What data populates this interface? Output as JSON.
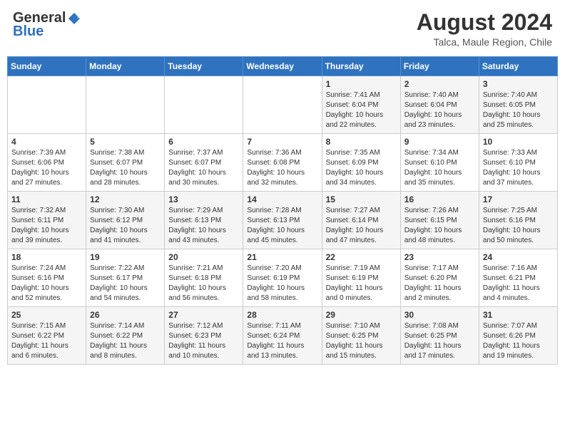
{
  "header": {
    "logo_general": "General",
    "logo_blue": "Blue",
    "month_year": "August 2024",
    "location": "Talca, Maule Region, Chile"
  },
  "days_of_week": [
    "Sunday",
    "Monday",
    "Tuesday",
    "Wednesday",
    "Thursday",
    "Friday",
    "Saturday"
  ],
  "weeks": [
    [
      {
        "day": "",
        "info": ""
      },
      {
        "day": "",
        "info": ""
      },
      {
        "day": "",
        "info": ""
      },
      {
        "day": "",
        "info": ""
      },
      {
        "day": "1",
        "info": "Sunrise: 7:41 AM\nSunset: 6:04 PM\nDaylight: 10 hours\nand 22 minutes."
      },
      {
        "day": "2",
        "info": "Sunrise: 7:40 AM\nSunset: 6:04 PM\nDaylight: 10 hours\nand 23 minutes."
      },
      {
        "day": "3",
        "info": "Sunrise: 7:40 AM\nSunset: 6:05 PM\nDaylight: 10 hours\nand 25 minutes."
      }
    ],
    [
      {
        "day": "4",
        "info": "Sunrise: 7:39 AM\nSunset: 6:06 PM\nDaylight: 10 hours\nand 27 minutes."
      },
      {
        "day": "5",
        "info": "Sunrise: 7:38 AM\nSunset: 6:07 PM\nDaylight: 10 hours\nand 28 minutes."
      },
      {
        "day": "6",
        "info": "Sunrise: 7:37 AM\nSunset: 6:07 PM\nDaylight: 10 hours\nand 30 minutes."
      },
      {
        "day": "7",
        "info": "Sunrise: 7:36 AM\nSunset: 6:08 PM\nDaylight: 10 hours\nand 32 minutes."
      },
      {
        "day": "8",
        "info": "Sunrise: 7:35 AM\nSunset: 6:09 PM\nDaylight: 10 hours\nand 34 minutes."
      },
      {
        "day": "9",
        "info": "Sunrise: 7:34 AM\nSunset: 6:10 PM\nDaylight: 10 hours\nand 35 minutes."
      },
      {
        "day": "10",
        "info": "Sunrise: 7:33 AM\nSunset: 6:10 PM\nDaylight: 10 hours\nand 37 minutes."
      }
    ],
    [
      {
        "day": "11",
        "info": "Sunrise: 7:32 AM\nSunset: 6:11 PM\nDaylight: 10 hours\nand 39 minutes."
      },
      {
        "day": "12",
        "info": "Sunrise: 7:30 AM\nSunset: 6:12 PM\nDaylight: 10 hours\nand 41 minutes."
      },
      {
        "day": "13",
        "info": "Sunrise: 7:29 AM\nSunset: 6:13 PM\nDaylight: 10 hours\nand 43 minutes."
      },
      {
        "day": "14",
        "info": "Sunrise: 7:28 AM\nSunset: 6:13 PM\nDaylight: 10 hours\nand 45 minutes."
      },
      {
        "day": "15",
        "info": "Sunrise: 7:27 AM\nSunset: 6:14 PM\nDaylight: 10 hours\nand 47 minutes."
      },
      {
        "day": "16",
        "info": "Sunrise: 7:26 AM\nSunset: 6:15 PM\nDaylight: 10 hours\nand 48 minutes."
      },
      {
        "day": "17",
        "info": "Sunrise: 7:25 AM\nSunset: 6:16 PM\nDaylight: 10 hours\nand 50 minutes."
      }
    ],
    [
      {
        "day": "18",
        "info": "Sunrise: 7:24 AM\nSunset: 6:16 PM\nDaylight: 10 hours\nand 52 minutes."
      },
      {
        "day": "19",
        "info": "Sunrise: 7:22 AM\nSunset: 6:17 PM\nDaylight: 10 hours\nand 54 minutes."
      },
      {
        "day": "20",
        "info": "Sunrise: 7:21 AM\nSunset: 6:18 PM\nDaylight: 10 hours\nand 56 minutes."
      },
      {
        "day": "21",
        "info": "Sunrise: 7:20 AM\nSunset: 6:19 PM\nDaylight: 10 hours\nand 58 minutes."
      },
      {
        "day": "22",
        "info": "Sunrise: 7:19 AM\nSunset: 6:19 PM\nDaylight: 11 hours\nand 0 minutes."
      },
      {
        "day": "23",
        "info": "Sunrise: 7:17 AM\nSunset: 6:20 PM\nDaylight: 11 hours\nand 2 minutes."
      },
      {
        "day": "24",
        "info": "Sunrise: 7:16 AM\nSunset: 6:21 PM\nDaylight: 11 hours\nand 4 minutes."
      }
    ],
    [
      {
        "day": "25",
        "info": "Sunrise: 7:15 AM\nSunset: 6:22 PM\nDaylight: 11 hours\nand 6 minutes."
      },
      {
        "day": "26",
        "info": "Sunrise: 7:14 AM\nSunset: 6:22 PM\nDaylight: 11 hours\nand 8 minutes."
      },
      {
        "day": "27",
        "info": "Sunrise: 7:12 AM\nSunset: 6:23 PM\nDaylight: 11 hours\nand 10 minutes."
      },
      {
        "day": "28",
        "info": "Sunrise: 7:11 AM\nSunset: 6:24 PM\nDaylight: 11 hours\nand 13 minutes."
      },
      {
        "day": "29",
        "info": "Sunrise: 7:10 AM\nSunset: 6:25 PM\nDaylight: 11 hours\nand 15 minutes."
      },
      {
        "day": "30",
        "info": "Sunrise: 7:08 AM\nSunset: 6:25 PM\nDaylight: 11 hours\nand 17 minutes."
      },
      {
        "day": "31",
        "info": "Sunrise: 7:07 AM\nSunset: 6:26 PM\nDaylight: 11 hours\nand 19 minutes."
      }
    ]
  ]
}
